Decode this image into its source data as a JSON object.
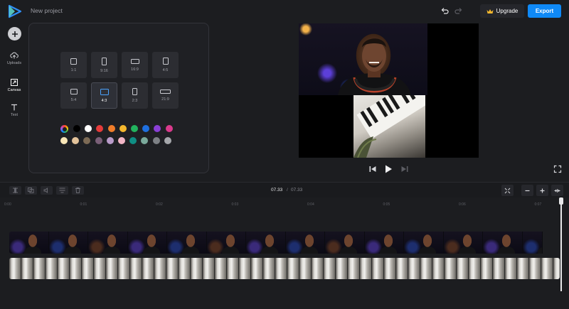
{
  "header": {
    "project_title": "New project",
    "upgrade_label": "Upgrade",
    "export_label": "Export",
    "accent_color": "#0f89f6"
  },
  "rail": {
    "items": [
      {
        "label": "Uploads",
        "icon": "cloud-upload-icon"
      },
      {
        "label": "Canvas",
        "icon": "canvas-resize-icon"
      },
      {
        "label": "Text",
        "icon": "text-icon"
      }
    ],
    "active": "Canvas"
  },
  "canvas_panel": {
    "ratios": [
      "1:1",
      "9:16",
      "16:9",
      "4:5",
      "5:4",
      "4:3",
      "2:3",
      "21:9"
    ],
    "selected_ratio": "4:3",
    "colors_row1": [
      "#000000",
      "#ffffff",
      "#e53b3b",
      "#f07d2a",
      "#f5b82e",
      "#22b35e",
      "#1e6fe0",
      "#8a3fd6",
      "#d93a8c"
    ],
    "colors_row2": [
      "#f9e6b7",
      "#e3c39b",
      "#7c6a55",
      "#7a5f78",
      "#b99bc9",
      "#f2b6c6",
      "#0f8e84",
      "#7aa99b",
      "#7d8085",
      "#a5a7ab"
    ]
  },
  "timeline": {
    "current_time": "07.33",
    "separator": "/",
    "total_time": "07.33",
    "ruler": [
      "0:00",
      "0:01",
      "0:02",
      "0:03",
      "0:04",
      "0:05",
      "0:06",
      "0:07"
    ]
  }
}
